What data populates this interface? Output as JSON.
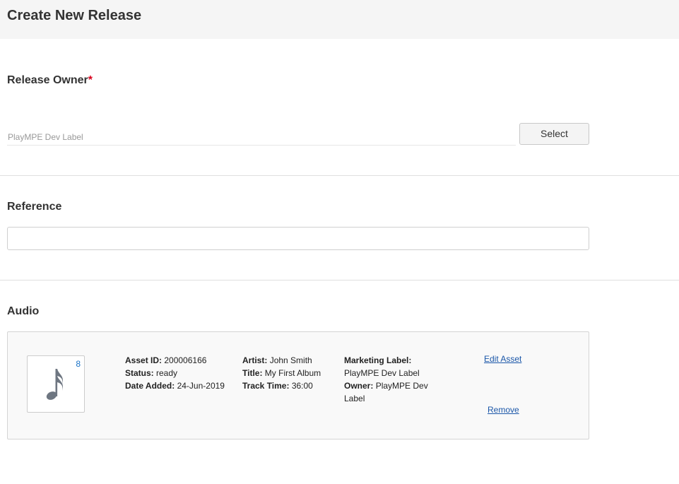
{
  "page": {
    "title": "Create New Release"
  },
  "release_owner": {
    "label": "Release Owner",
    "required_mark": "*",
    "value": "PlayMPE Dev Label",
    "select_label": "Select"
  },
  "reference": {
    "label": "Reference",
    "value": ""
  },
  "audio": {
    "label": "Audio",
    "asset": {
      "thumb_icon": "music-note-icon",
      "count": "8",
      "asset_id_label": "Asset ID:",
      "asset_id": "200006166",
      "status_label": "Status:",
      "status": "ready",
      "date_added_label": "Date Added:",
      "date_added": "24-Jun-2019",
      "artist_label": "Artist:",
      "artist": "John Smith",
      "title_label": "Title:",
      "title": "My First Album",
      "track_time_label": "Track Time:",
      "track_time": "36:00",
      "marketing_label_label": "Marketing Label:",
      "marketing_label": "PlayMPE Dev Label",
      "owner_label": "Owner:",
      "owner_line1": "PlayMPE Dev",
      "owner_line2": "Label",
      "edit_label": "Edit Asset",
      "remove_label": "Remove"
    }
  },
  "colors": {
    "header_bg": "#f5f5f5",
    "required": "#d9001b",
    "link": "#1a56a8",
    "count": "#1a73c8"
  }
}
